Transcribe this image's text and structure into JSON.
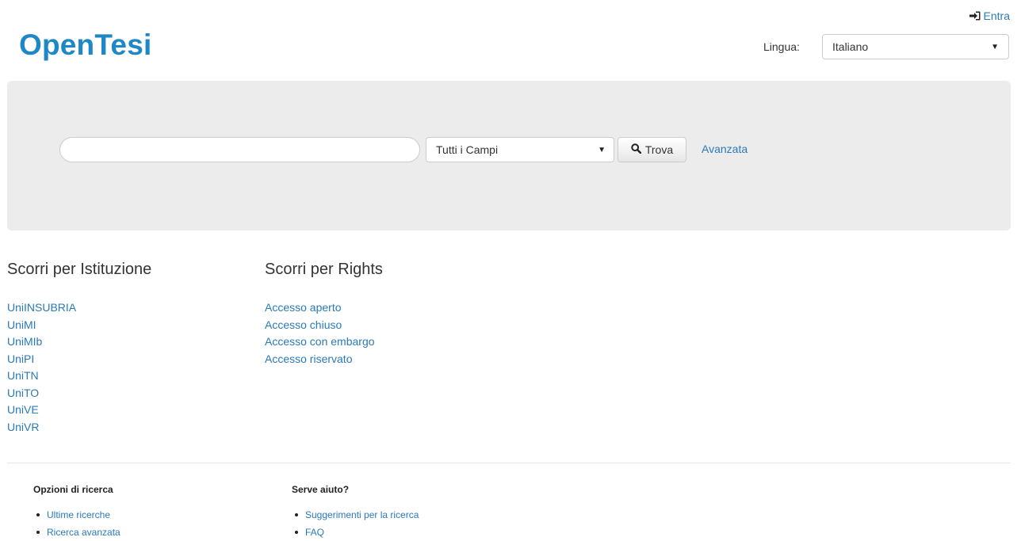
{
  "header": {
    "login_label": "Entra",
    "logo": "OpenTesi",
    "language_label": "Lingua:",
    "language_selected": "Italiano"
  },
  "search": {
    "query_value": "",
    "field_selected": "Tutti i Campi",
    "find_label": "Trova",
    "advanced_label": "Avanzata"
  },
  "browse_institution": {
    "title": "Scorri per Istituzione",
    "items": [
      "UniINSUBRIA",
      "UniMI",
      "UniMIb",
      "UniPI",
      "UniTN",
      "UniTO",
      "UniVE",
      "UniVR"
    ]
  },
  "browse_rights": {
    "title": "Scorri per Rights",
    "items": [
      "Accesso aperto",
      "Accesso chiuso",
      "Accesso con embargo",
      "Accesso riservato"
    ]
  },
  "footer": {
    "search_options": {
      "title": "Opzioni di ricerca",
      "items": [
        "Ultime ricerche",
        "Ricerca avanzata"
      ]
    },
    "help": {
      "title": "Serve aiuto?",
      "items": [
        "Suggerimenti per la ricerca",
        "FAQ"
      ]
    }
  },
  "icons": {
    "login": "sign-in-icon",
    "find": "search-icon",
    "dropdown": "caret-down-icon"
  },
  "colors": {
    "link": "#2a7ab8",
    "logo": "#1e88c6",
    "search_band": "#ececec"
  }
}
